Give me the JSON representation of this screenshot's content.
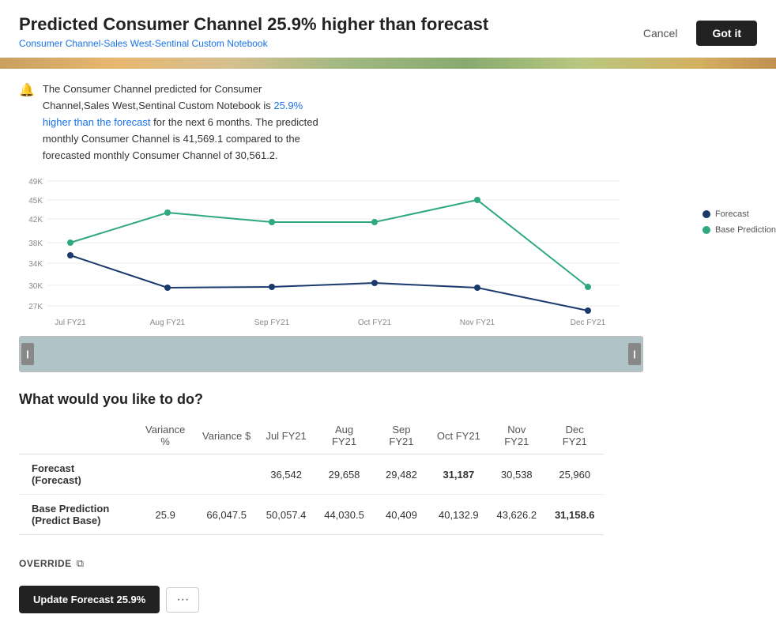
{
  "header": {
    "title": "Predicted Consumer Channel 25.9% higher than forecast",
    "subtitle": "Consumer Channel-Sales West-Sentinal Custom Notebook",
    "cancel_label": "Cancel",
    "got_it_label": "Got it"
  },
  "info": {
    "icon": "🔔",
    "text_parts": {
      "before": "The Consumer Channel predicted for Consumer Channel,Sales West,Sentinal Custom Notebook is ",
      "highlight1": "25.9% higher than the forecast",
      "middle": " for the next 6 months. The predicted monthly Consumer Channel is 41,569.1 compared to the forecasted monthly Consumer Channel of 30,561.2."
    }
  },
  "chart": {
    "y_labels": [
      "49K",
      "45K",
      "42K",
      "38K",
      "34K",
      "30K",
      "27K"
    ],
    "x_labels": [
      "Jul FY21",
      "Aug FY21",
      "Sep FY21",
      "Oct FY21",
      "Nov FY21",
      "Dec FY21"
    ],
    "legend": {
      "forecast_label": "Forecast",
      "forecast_color": "#1a3a6e",
      "base_prediction_label": "Base Prediction",
      "base_prediction_color": "#2ea87e"
    }
  },
  "action_section": {
    "title": "What would you like to do?"
  },
  "table": {
    "headers": [
      "",
      "Variance %",
      "Variance $",
      "Jul FY21",
      "Aug FY21",
      "Sep FY21",
      "Oct FY21",
      "Nov FY21",
      "Dec FY21"
    ],
    "rows": [
      {
        "label": "Forecast\n(Forecast)",
        "variance_pct": "",
        "variance_dollar": "",
        "jul": "36,542",
        "aug": "29,658",
        "sep": "29,482",
        "oct": "31,187",
        "nov": "30,538",
        "dec": "25,960",
        "oct_highlight": true
      },
      {
        "label": "Base Prediction\n(Predict Base)",
        "variance_pct": "25.9",
        "variance_dollar": "66,047.5",
        "jul": "50,057.4",
        "aug": "44,030.5",
        "sep": "40,409",
        "oct": "40,132.9",
        "nov": "43,626.2",
        "dec": "31,158.6",
        "dec_highlight": true
      }
    ]
  },
  "override": {
    "label": "OVERRIDE",
    "icon": "⧉"
  },
  "bottom": {
    "update_label": "Update Forecast 25.9%",
    "more_label": "···"
  }
}
